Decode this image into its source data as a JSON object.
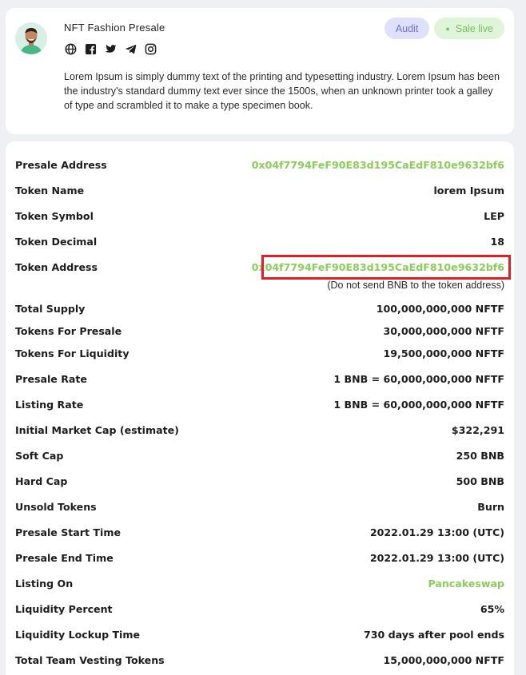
{
  "header": {
    "project_title": "NFT Fashion Presale",
    "description": "Lorem Ipsum is simply dummy text of the printing and typesetting industry. Lorem Ipsum has been the industry's standard dummy text ever since the 1500s, when an unknown printer took a galley of type and scrambled it to make a type specimen book.",
    "social_icons": [
      "globe-icon",
      "facebook-icon",
      "twitter-icon",
      "telegram-icon",
      "instagram-icon"
    ],
    "badges": {
      "audit": "Audit",
      "sale_live": "Sale live"
    }
  },
  "details": {
    "presale_address": {
      "label": "Presale Address",
      "value": "0x04f7794FeF90E83d195CaEdF810e9632bf6"
    },
    "token_name": {
      "label": "Token Name",
      "value": "lorem Ipsum"
    },
    "token_symbol": {
      "label": "Token Symbol",
      "value": "LEP"
    },
    "token_decimal": {
      "label": "Token Decimal",
      "value": "18"
    },
    "token_address": {
      "label": "Token Address",
      "value": "0x04f7794FeF90E83d195CaEdF810e9632bf6",
      "note": "(Do not send BNB to the token address)"
    },
    "total_supply": {
      "label": "Total Supply",
      "value": "100,000,000,000 NFTF"
    },
    "tokens_for_presale": {
      "label": "Tokens For Presale",
      "value": "30,000,000,000 NFTF"
    },
    "tokens_for_liquidity": {
      "label": "Tokens For Liquidity",
      "value": "19,500,000,000 NFTF"
    },
    "presale_rate": {
      "label": "Presale Rate",
      "value": "1 BNB = 60,000,000,000 NFTF"
    },
    "listing_rate": {
      "label": "Listing Rate",
      "value": "1 BNB = 60,000,000,000 NFTF"
    },
    "initial_market_cap": {
      "label": "Initial Market Cap (estimate)",
      "value": "$322,291"
    },
    "soft_cap": {
      "label": "Soft Cap",
      "value": "250 BNB"
    },
    "hard_cap": {
      "label": "Hard Cap",
      "value": "500 BNB"
    },
    "unsold_tokens": {
      "label": "Unsold Tokens",
      "value": "Burn"
    },
    "presale_start_time": {
      "label": "Presale Start Time",
      "value": "2022.01.29 13:00 (UTC)"
    },
    "presale_end_time": {
      "label": "Presale End Time",
      "value": "2022.01.29 13:00 (UTC)"
    },
    "listing_on": {
      "label": "Listing On",
      "value": "Pancakeswap"
    },
    "liquidity_percent": {
      "label": "Liquidity Percent",
      "value": "65%"
    },
    "liquidity_lockup_time": {
      "label": "Liquidity Lockup Time",
      "value": "730 days after pool ends"
    },
    "total_team_vesting_tokens": {
      "label": "Total Team Vesting Tokens",
      "value": "15,000,000,000 NFTF"
    }
  },
  "colors": {
    "accent_green": "#8ccc5a",
    "audit_purple": "#6d6fe6",
    "highlight_red": "#e01e24"
  }
}
